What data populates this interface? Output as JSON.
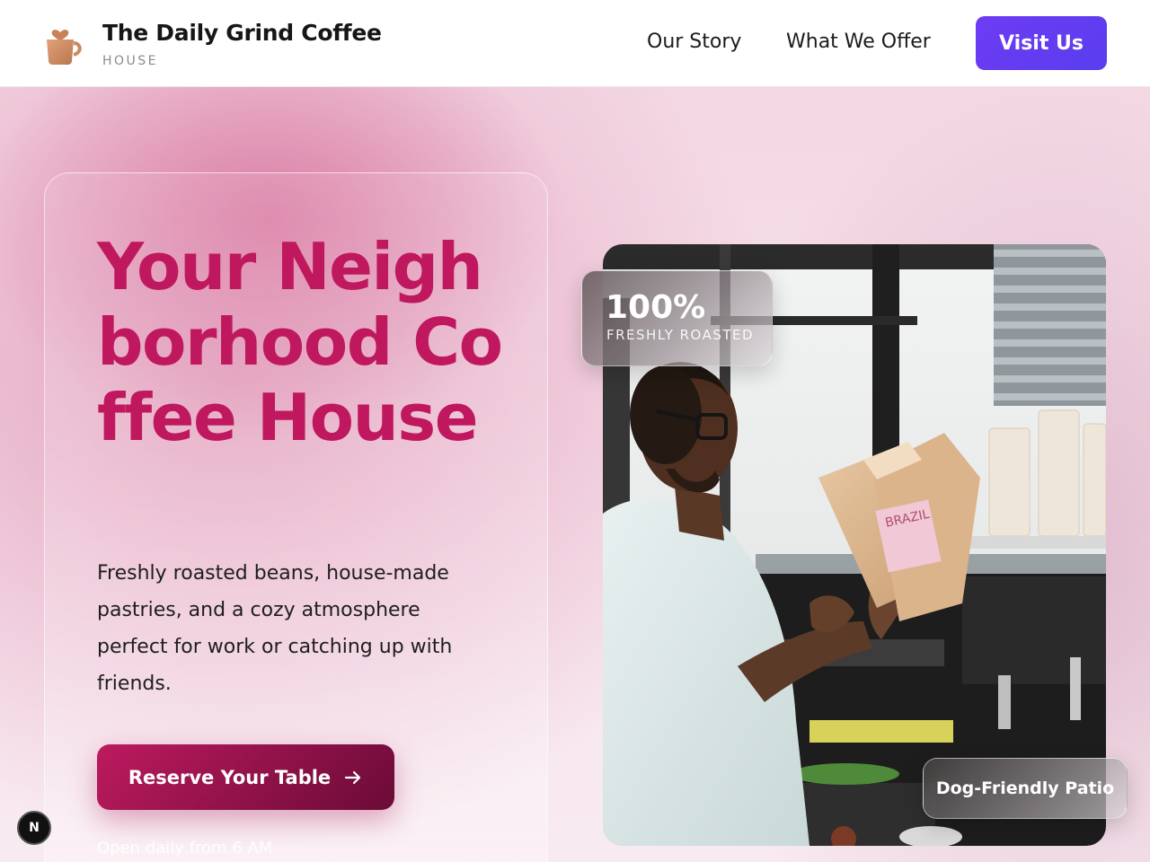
{
  "header": {
    "brand_name": "The Daily Grind Coffee",
    "brand_sub": "HOUSE",
    "nav": {
      "our_story": "Our Story",
      "what_we_offer": "What We Offer"
    },
    "visit_button": "Visit Us"
  },
  "hero": {
    "title": "Your Neighborhood Coffee House",
    "description": "Freshly roasted beans, house-made pastries, and a cozy atmosphere perfect for work or catching up with friends.",
    "cta": "Reserve Your Table",
    "cta_icon": "arrow-right-icon",
    "hours": "Open daily from 6 AM"
  },
  "badges": {
    "roasted_value": "100%",
    "roasted_label": "FRESHLY ROASTED",
    "patio": "Dog-Friendly Patio"
  },
  "dev_indicator": "N",
  "colors": {
    "accent": "#c0185e",
    "visit_button": "#6d3cf2",
    "cta_start": "#bd1a5f",
    "cta_end": "#6a0b36"
  }
}
